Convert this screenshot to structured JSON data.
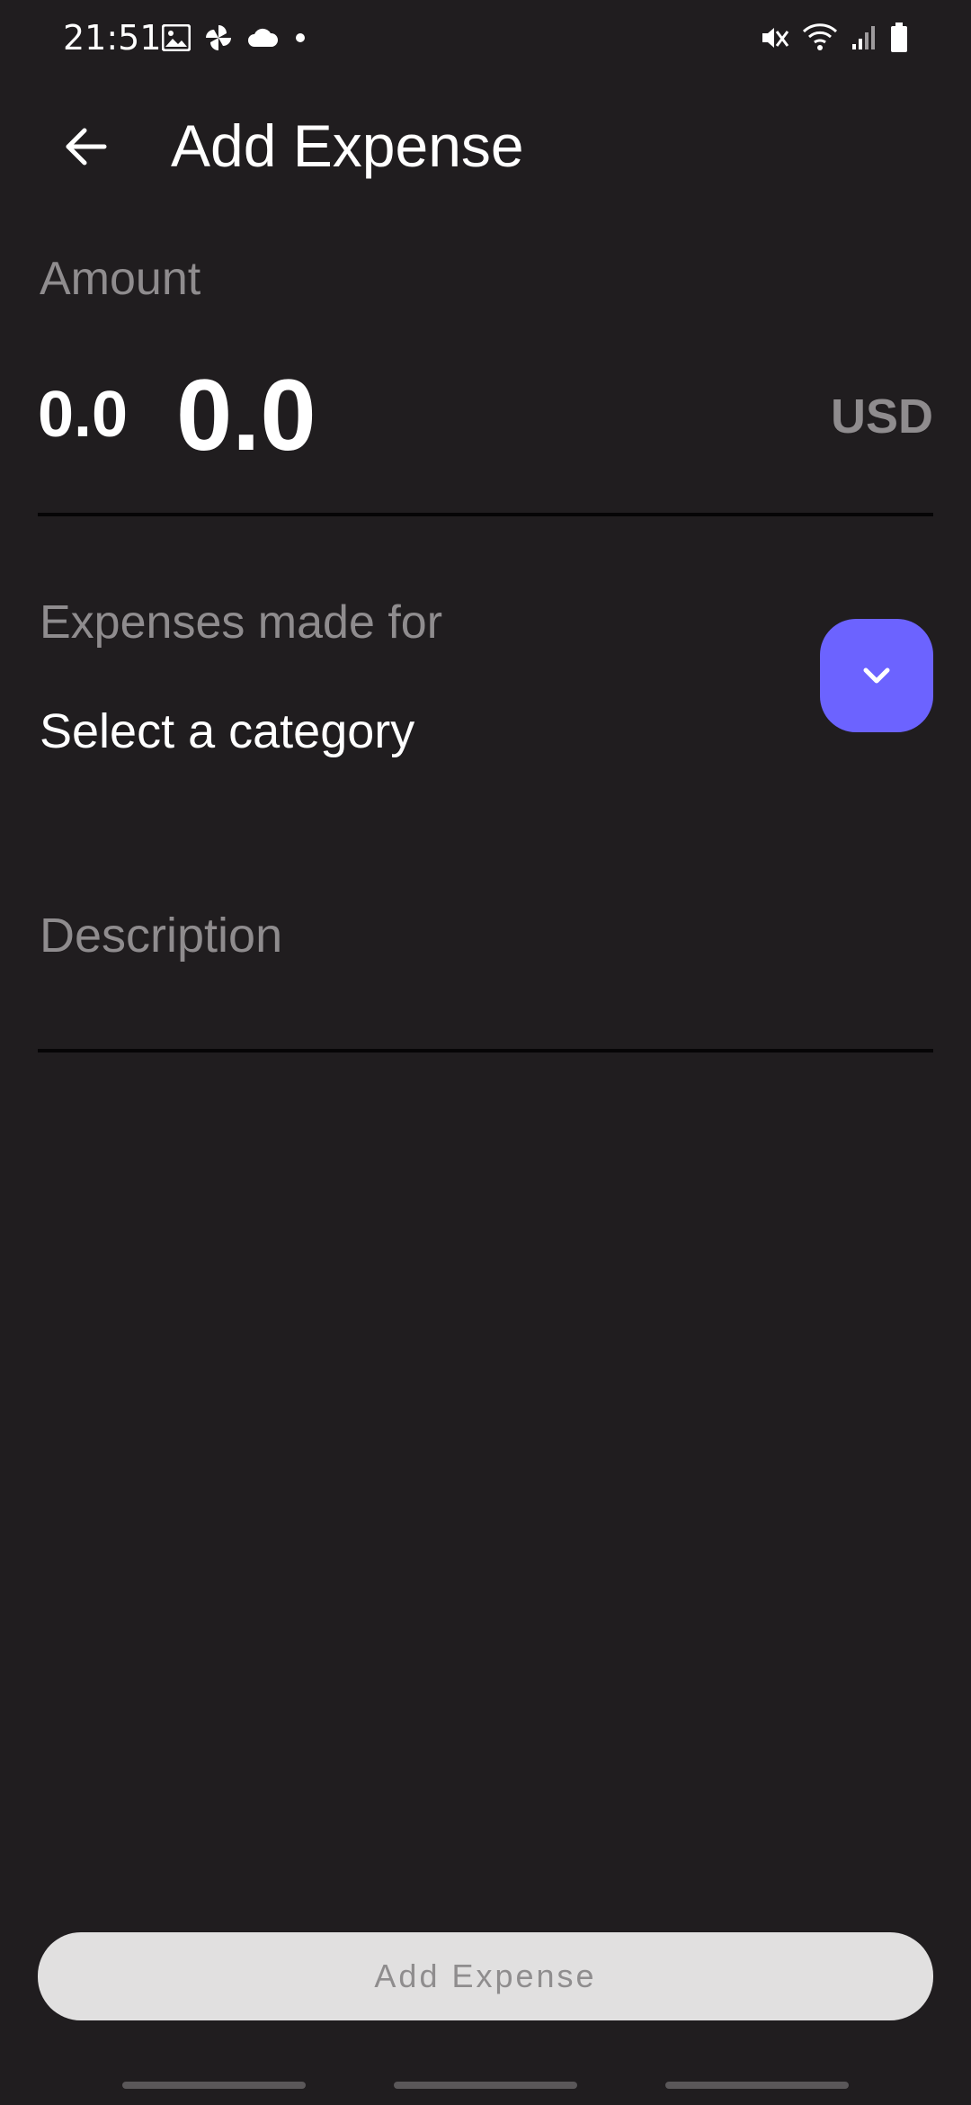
{
  "status_bar": {
    "time": "21:51",
    "left_icons": [
      "gallery-icon",
      "pinwheel-icon",
      "cloud-icon",
      "dot-icon"
    ],
    "right_icons": [
      "mute-icon",
      "wifi-icon",
      "signal-icon",
      "battery-icon"
    ]
  },
  "app_bar": {
    "title": "Add Expense",
    "back_icon": "arrow-back-icon"
  },
  "amount": {
    "label": "Amount",
    "small_value": "0.0",
    "value": "0.0",
    "currency": "USD"
  },
  "category": {
    "label": "Expenses made for",
    "value": "Select a category",
    "dropdown_icon": "chevron-down-icon"
  },
  "description": {
    "placeholder": "Description",
    "value": ""
  },
  "submit": {
    "label": "Add Expense"
  },
  "colors": {
    "background": "#201d1f",
    "accent": "#6c63ff",
    "muted_text": "#8f8c8e",
    "button_disabled_bg": "#e1e0e0"
  }
}
